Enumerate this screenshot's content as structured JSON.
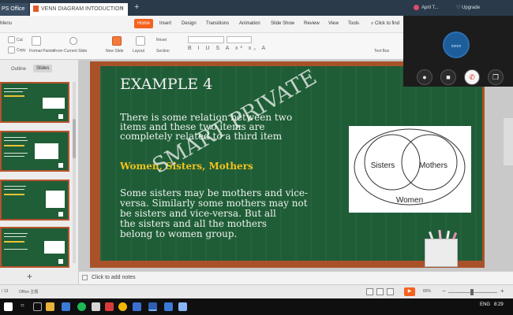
{
  "titlebar": {
    "app_tab": "PS Office",
    "doc_tab": "VENN DIAGRAM INTODUCTION",
    "close": "×",
    "add_tab": "+",
    "user": "April T...",
    "upgrade": "Upgrade"
  },
  "menu": {
    "left": "Menu",
    "tabs": [
      "Home",
      "Insert",
      "Design",
      "Transitions",
      "Animation",
      "Slide Show",
      "Review",
      "View",
      "Tools"
    ],
    "search": "Click to find"
  },
  "ribbon": {
    "cut": "Cut",
    "copy": "Copy",
    "format_painter": "Format Painter",
    "from_current_slide": "From Current Slide",
    "new_slide": "New Slide",
    "layout": "Layout",
    "reset": "Reset",
    "section": "Section",
    "text_box": "Text Box",
    "format_row": "B I U S A x² x₂ A"
  },
  "call": {
    "avatar_text": "mmm",
    "buttons": [
      "mic-icon",
      "video-icon",
      "hangup-icon",
      "switch-icon"
    ]
  },
  "left_panel": {
    "outline": "Outline",
    "slides": "Slides",
    "add": "+"
  },
  "slide": {
    "title": "EXAMPLE 4",
    "para1": [
      "There is some relation between two",
      "items and these two items are",
      "completely related to a third item"
    ],
    "highlight": "Women, Sisters, Mothers",
    "para2": [
      "Some sisters may be mothers and vice-",
      "versa. Similarly some mothers may not",
      "be sisters and vice-versa. But all",
      "the sisters and all the mothers",
      "belong to women group."
    ],
    "watermark": "SMART PRIVATE",
    "venn": {
      "sisters": "Sisters",
      "mothers": "Mothers",
      "women": "Women"
    }
  },
  "notes": {
    "placeholder": "Click to add notes"
  },
  "statusbar": {
    "slide_count": "/ 13",
    "theme": "Office 主题",
    "zoom": "80%",
    "zoom_minus": "−",
    "zoom_plus": "+"
  },
  "taskbar": {
    "lang": "ENG",
    "time": "8:29"
  }
}
